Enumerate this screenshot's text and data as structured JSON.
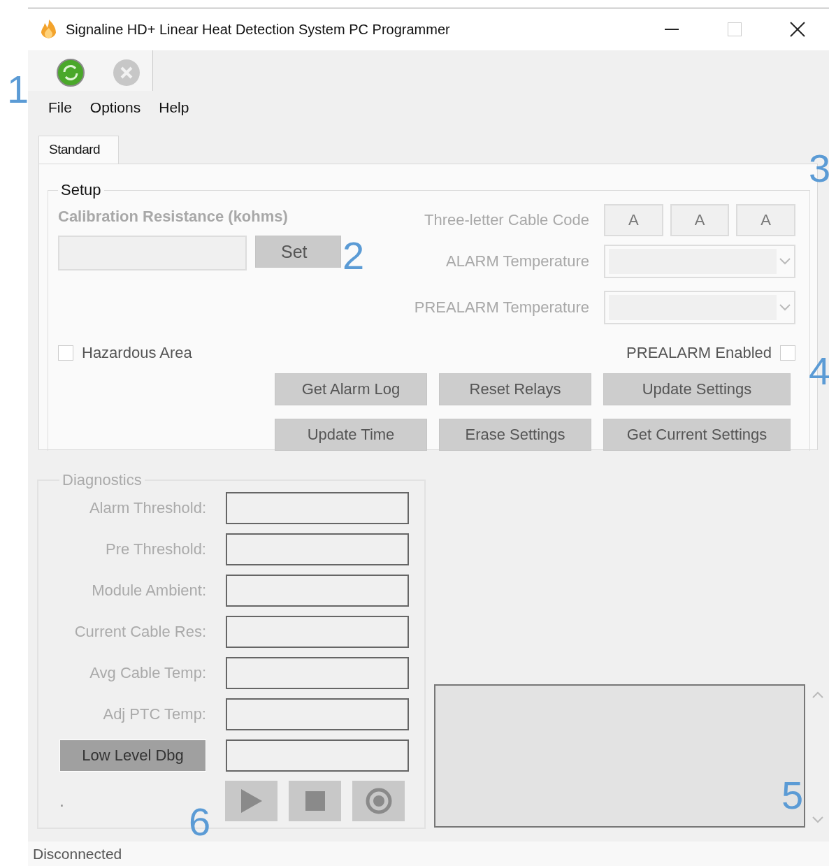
{
  "window": {
    "title": "Signaline HD+ Linear Heat Detection System PC Programmer"
  },
  "toolbar": {
    "buttons": [
      {
        "kind": "connect",
        "disabled": false
      },
      {
        "kind": "disconnect",
        "disabled": true
      }
    ]
  },
  "menu": [
    "File",
    "Options",
    "Help"
  ],
  "tabs": [
    {
      "label": "Standard",
      "selected": true
    }
  ],
  "setup": {
    "title": "Setup",
    "calibration_label": "Calibration Resistance (kohms)",
    "set_button": "Set",
    "cable_code": {
      "label": "Three-letter Cable Code",
      "letters": [
        "A",
        "A",
        "A"
      ]
    },
    "alarm_temperature": {
      "label": "ALARM Temperature"
    },
    "prealarm_temperature": {
      "label": "PREALARM Temperature"
    },
    "hazardous_area": {
      "label": "Hazardous Area",
      "checked": false
    },
    "prealarm_enabled": {
      "label": "PREALARM Enabled",
      "checked": false
    },
    "buttons": [
      "Get Alarm Log",
      "Reset Relays",
      "Update Settings",
      "Update Time",
      "Erase Settings",
      "Get Current Settings"
    ]
  },
  "diagnostics": {
    "title": "Diagnostics",
    "fields": [
      "Alarm Threshold:",
      "Pre Threshold:",
      "Module Ambient:",
      "Current Cable Res:",
      "Avg Cable Temp:",
      "Adj PTC Temp:"
    ],
    "low_level_button": "Low Level Dbg",
    "indicator": ".",
    "media_buttons": [
      {
        "kind": "play"
      },
      {
        "kind": "stop"
      },
      {
        "kind": "record"
      }
    ]
  },
  "status_bar": {
    "text": "Disconnected"
  },
  "callouts": [
    "1",
    "2",
    "3",
    "4",
    "5",
    "6"
  ]
}
